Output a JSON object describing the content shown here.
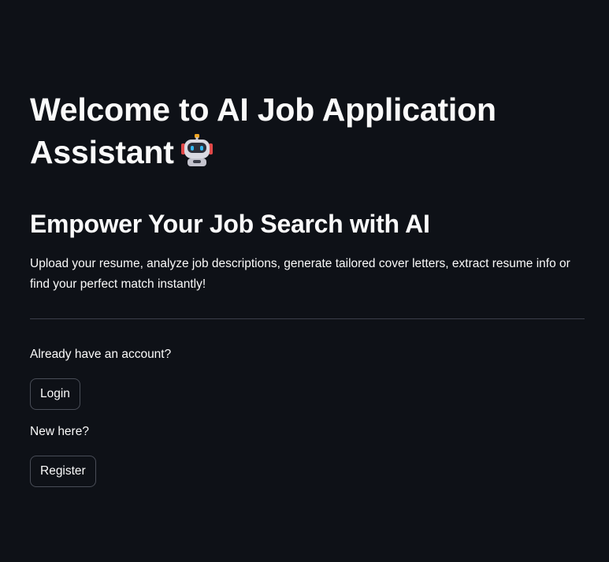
{
  "hero": {
    "title": "Welcome to AI Job Application Assistant",
    "title_icon": "robot-icon",
    "subtitle": "Empower Your Job Search with AI",
    "description": "Upload your resume, analyze job descriptions, generate tailored cover letters, extract resume info or find your perfect match instantly!"
  },
  "auth": {
    "login_prompt": "Already have an account?",
    "login_label": "Login",
    "register_prompt": "New here?",
    "register_label": "Register"
  },
  "colors": {
    "background": "#0e1117",
    "text": "#fafafa",
    "divider": "#3b3f4a",
    "button_border": "#494d57"
  }
}
